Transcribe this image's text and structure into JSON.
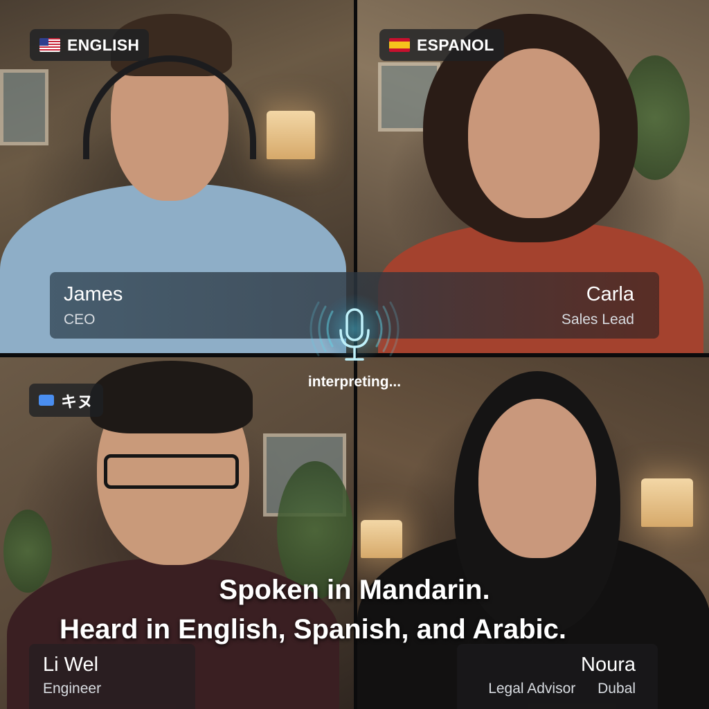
{
  "participants": [
    {
      "id": "james",
      "name": "James",
      "role": "CEO",
      "language": "ENGLISH",
      "flag": "us-flag"
    },
    {
      "id": "carla",
      "name": "Carla",
      "role": "Sales Lead",
      "language": "ESPANOL",
      "flag": "es-flag"
    },
    {
      "id": "li",
      "name": "Li Wel",
      "role": "Engineer",
      "language": "キヌ",
      "flag": "zh-flag"
    },
    {
      "id": "noura",
      "name": "Noura",
      "role": "Legal Advisor",
      "location": "Dubal"
    }
  ],
  "interpreter": {
    "status": "interpreting...",
    "icon": "microphone-icon",
    "accent": "#5fd3e6"
  },
  "captions": {
    "line1": "Spoken in Mandarin.",
    "line2": "Heard in English, Spanish, and Arabic."
  }
}
